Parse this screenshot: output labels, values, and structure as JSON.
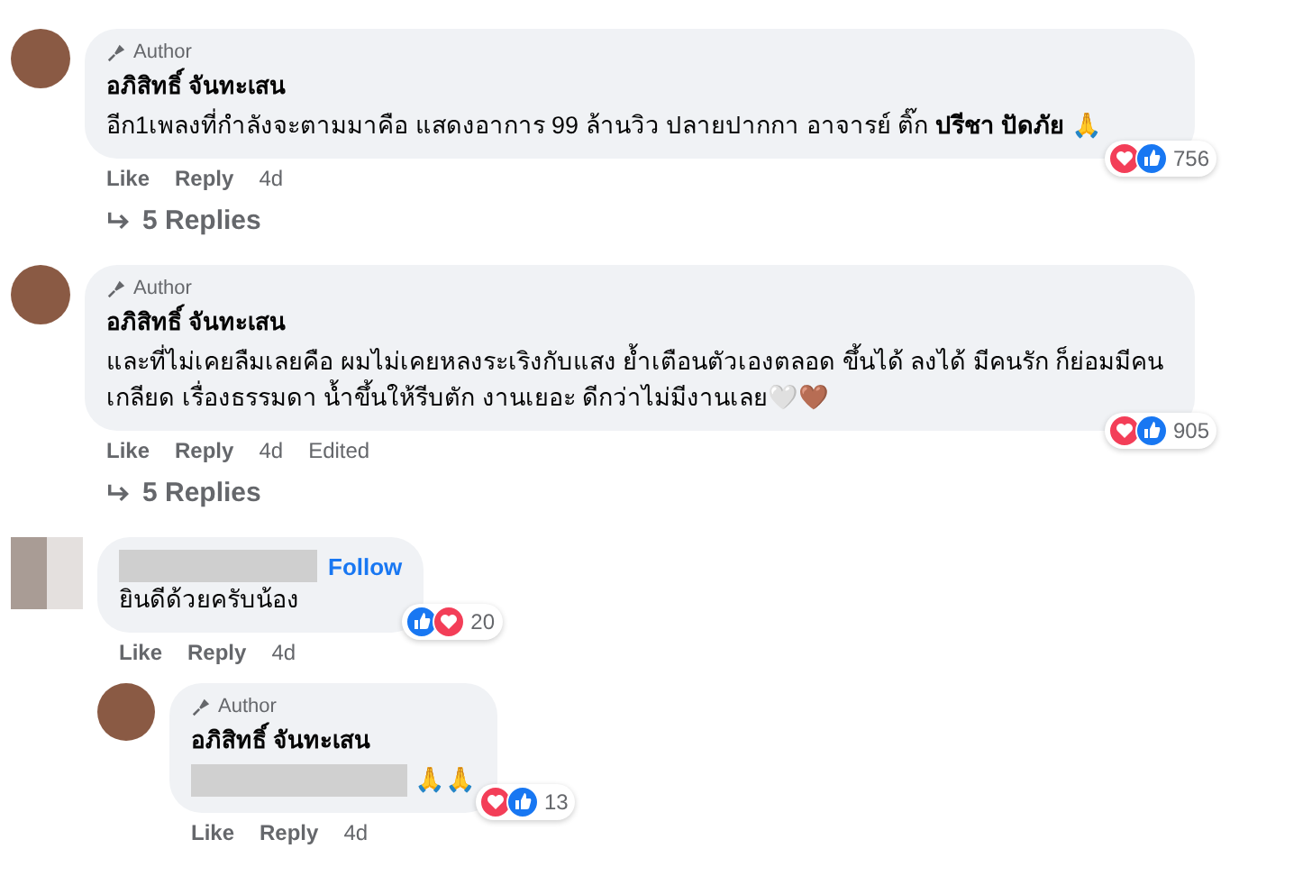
{
  "comments": [
    {
      "kind": "author",
      "badge": "Author",
      "name": "อภิสิทธิ์ จันทะเสน",
      "text": "อีก1เพลงที่กำลังจะตามมาคือ แสดงอาการ 99 ล้านวิว ปลายปากกา อาจารย์ ติ๊ก **ปรีชา ปัดภัย** 🙏",
      "reactions": [
        {
          "kind": "love"
        },
        {
          "kind": "like"
        }
      ],
      "count": "756",
      "actions": [
        "Like",
        "Reply",
        "4d"
      ],
      "replies_link": "5 Replies"
    },
    {
      "kind": "author",
      "badge": "Author",
      "name": "อภิสิทธิ์ จันทะเสน",
      "text": "และที่ไม่เคยลืมเลยคือ ผมไม่เคยหลงระเริงกับแสง ย้ำเตือนตัวเองตลอด ขึ้นได้ ลงได้ มีคนรัก ก็ย่อมมีคนเกลียด เรื่องธรรมดา น้ำขึ้นให้รีบตัก งานเยอะ ดีกว่าไม่มีงานเลย🤍🤎",
      "reactions": [
        {
          "kind": "love"
        },
        {
          "kind": "like"
        }
      ],
      "count": "905",
      "actions": [
        "Like",
        "Reply",
        "4d",
        "Edited"
      ],
      "replies_link": "5 Replies"
    },
    {
      "kind": "user",
      "follow": "Follow",
      "text": "ยินดีด้วยครับน้อง",
      "reactions": [
        {
          "kind": "like"
        },
        {
          "kind": "love"
        }
      ],
      "count": "20",
      "actions": [
        "Like",
        "Reply",
        "4d"
      ],
      "replies": [
        {
          "kind": "author",
          "badge": "Author",
          "name": "อภิสิทธิ์ จันทะเสน",
          "text": "🙏🙏",
          "reactions": [
            {
              "kind": "love"
            },
            {
              "kind": "like"
            }
          ],
          "count": "13",
          "actions": [
            "Like",
            "Reply",
            "4d"
          ]
        }
      ]
    }
  ]
}
